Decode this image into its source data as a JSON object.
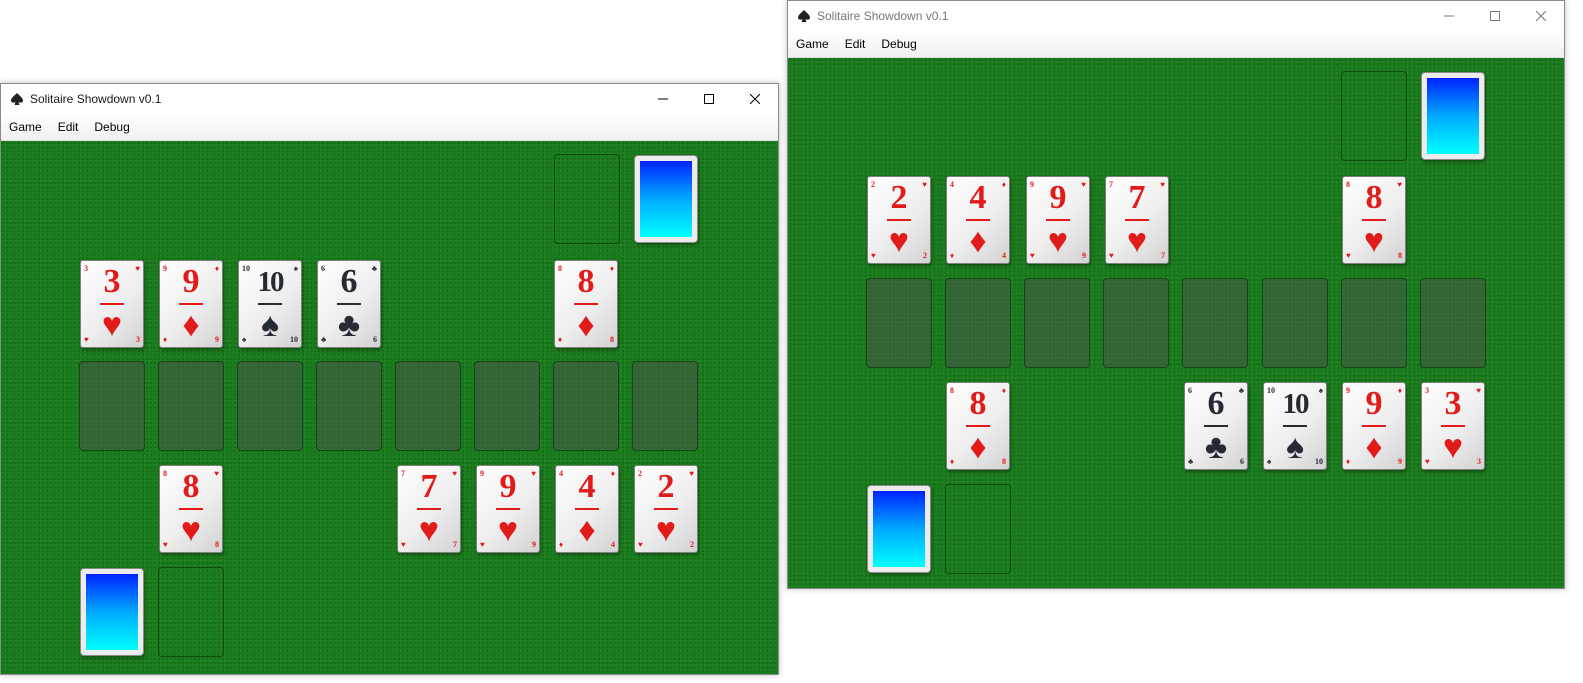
{
  "left_window": {
    "title": "Solitaire Showdown v0.1",
    "menu": [
      "Game",
      "Edit",
      "Debug"
    ],
    "cards": [
      {
        "rank": "3",
        "suit": "hearts",
        "glyph": "♥",
        "color": "red"
      },
      {
        "rank": "9",
        "suit": "diamonds",
        "glyph": "♦",
        "color": "red"
      },
      {
        "rank": "10",
        "suit": "spades",
        "glyph": "♠",
        "color": "black"
      },
      {
        "rank": "6",
        "suit": "clubs",
        "glyph": "♣",
        "color": "black"
      },
      {
        "rank": "8",
        "suit": "diamonds",
        "glyph": "♦",
        "color": "red"
      },
      {
        "rank": "8",
        "suit": "hearts",
        "glyph": "♥",
        "color": "red"
      },
      {
        "rank": "7",
        "suit": "hearts",
        "glyph": "♥",
        "color": "red"
      },
      {
        "rank": "9",
        "suit": "hearts",
        "glyph": "♥",
        "color": "red"
      },
      {
        "rank": "4",
        "suit": "diamonds",
        "glyph": "♦",
        "color": "red"
      },
      {
        "rank": "2",
        "suit": "hearts",
        "glyph": "♥",
        "color": "red"
      }
    ]
  },
  "right_window": {
    "title": "Solitaire Showdown v0.1",
    "menu": [
      "Game",
      "Edit",
      "Debug"
    ],
    "cards": [
      {
        "rank": "2",
        "suit": "hearts",
        "glyph": "♥",
        "color": "red"
      },
      {
        "rank": "4",
        "suit": "diamonds",
        "glyph": "♦",
        "color": "red"
      },
      {
        "rank": "9",
        "suit": "hearts",
        "glyph": "♥",
        "color": "red"
      },
      {
        "rank": "7",
        "suit": "hearts",
        "glyph": "♥",
        "color": "red"
      },
      {
        "rank": "8",
        "suit": "hearts",
        "glyph": "♥",
        "color": "red"
      },
      {
        "rank": "8",
        "suit": "diamonds",
        "glyph": "♦",
        "color": "red"
      },
      {
        "rank": "6",
        "suit": "clubs",
        "glyph": "♣",
        "color": "black"
      },
      {
        "rank": "10",
        "suit": "spades",
        "glyph": "♠",
        "color": "black"
      },
      {
        "rank": "9",
        "suit": "diamonds",
        "glyph": "♦",
        "color": "red"
      },
      {
        "rank": "3",
        "suit": "hearts",
        "glyph": "♥",
        "color": "red"
      }
    ]
  },
  "colors": {
    "felt": "#1a7d1d",
    "card_red": "#e11a1a",
    "card_black": "#262a33",
    "card_back_top": "#0022ff",
    "card_back_bottom": "#00ffff"
  },
  "icons": {
    "app": "spade-icon",
    "minimize": "minimize-icon",
    "maximize": "maximize-icon",
    "close": "close-icon"
  }
}
